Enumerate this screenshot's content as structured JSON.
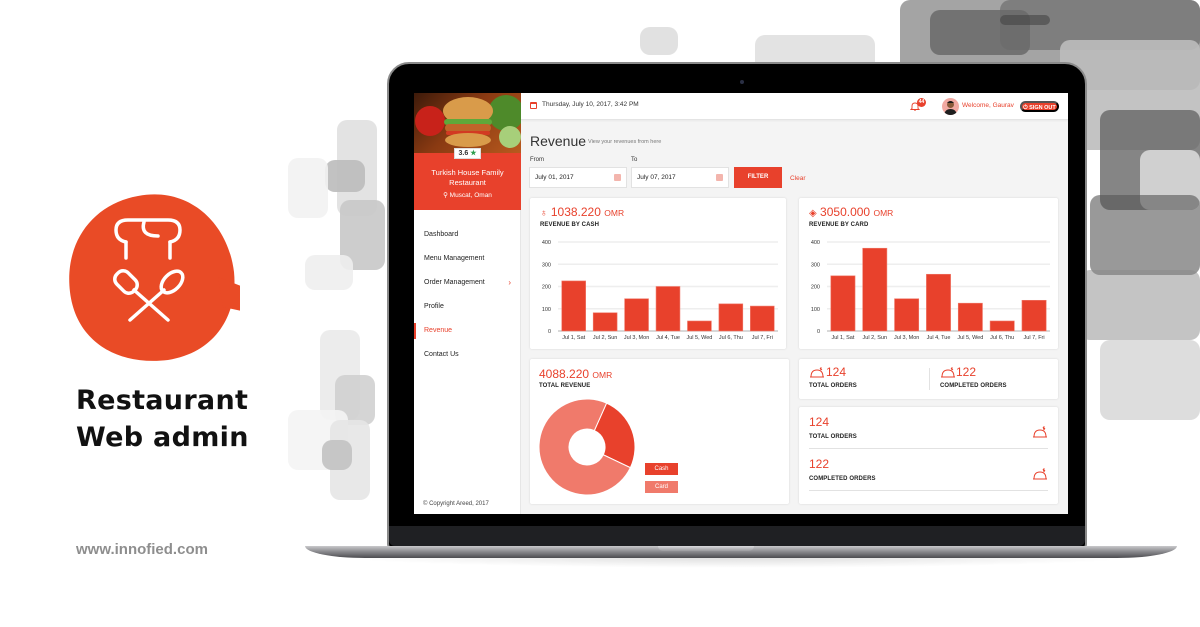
{
  "promo": {
    "title_line1": "Restaurant",
    "title_line2": "Web admin",
    "url": "www.innofied.com",
    "icon": "chef-hat-spatula-icon"
  },
  "colors": {
    "accent": "#e8412c",
    "accent_light": "#f07a6b",
    "blob": "#e94b26"
  },
  "sidebar": {
    "restaurant_name": "Turkish House Family Restaurant",
    "location": "Muscat, Oman",
    "rating": "3.6",
    "items": [
      {
        "label": "Dashboard",
        "active": false
      },
      {
        "label": "Menu Management",
        "active": false
      },
      {
        "label": "Order Management",
        "active": false,
        "has_submenu": true
      },
      {
        "label": "Profile",
        "active": false
      },
      {
        "label": "Revenue",
        "active": true
      },
      {
        "label": "Contact Us",
        "active": false
      }
    ],
    "copyright": "© Copyright Areed, 2017"
  },
  "header": {
    "datetime": "Thursday, July 10, 2017, 3:42 PM",
    "notification_count": "44",
    "welcome": "Welcome, Gaurav",
    "signout_label": "SIGN OUT"
  },
  "page": {
    "title": "Revenue",
    "subtitle": "View your revenues from here",
    "from_label": "From",
    "to_label": "To",
    "from_value": "July 01, 2017",
    "to_value": "July 07, 2017",
    "filter_label": "FILTER",
    "clear_label": "Clear"
  },
  "cards": {
    "cash": {
      "amount": "1038.220",
      "unit": "OMR",
      "label": "REVENUE BY CASH"
    },
    "card": {
      "amount": "3050.000",
      "unit": "OMR",
      "label": "REVENUE BY CARD"
    },
    "total": {
      "amount": "4088.220",
      "unit": "OMR",
      "label": "TOTAL REVENUE",
      "legend": [
        "Cash",
        "Card"
      ]
    },
    "orders_row": {
      "total_value": "124",
      "total_label": "TOTAL ORDERS",
      "completed_value": "122",
      "completed_label": "COMPLETED ORDERS"
    },
    "orders_list": [
      {
        "value": "124",
        "label": "TOTAL ORDERS"
      },
      {
        "value": "122",
        "label": "COMPLETED ORDERS"
      }
    ]
  },
  "chart_data": [
    {
      "type": "bar",
      "title": "REVENUE BY CASH",
      "categories": [
        "Jul 1, Sat",
        "Jul 2, Sun",
        "Jul 3, Mon",
        "Jul 4, Tue",
        "Jul 5, Wed",
        "Jul 6, Thu",
        "Jul 7, Fri"
      ],
      "values": [
        225,
        82,
        145,
        200,
        45,
        122,
        112
      ],
      "yticks": [
        0,
        100,
        200,
        300,
        400
      ],
      "ylim": [
        0,
        400
      ],
      "grid": true,
      "color": "#e8412c"
    },
    {
      "type": "bar",
      "title": "REVENUE BY CARD",
      "categories": [
        "Jul 1, Sat",
        "Jul 2, Sun",
        "Jul 3, Mon",
        "Jul 4, Tue",
        "Jul 5, Wed",
        "Jul 6, Thu",
        "Jul 7, Fri"
      ],
      "values": [
        248,
        372,
        145,
        255,
        125,
        45,
        138
      ],
      "yticks": [
        0,
        100,
        200,
        300,
        400
      ],
      "ylim": [
        0,
        400
      ],
      "grid": true,
      "color": "#e8412c"
    },
    {
      "type": "pie",
      "title": "TOTAL REVENUE",
      "labels": [
        "Cash",
        "Card"
      ],
      "values": [
        1038.22,
        3050.0
      ],
      "colors": [
        "#e8412c",
        "#f07a6b"
      ],
      "donut": true
    }
  ]
}
